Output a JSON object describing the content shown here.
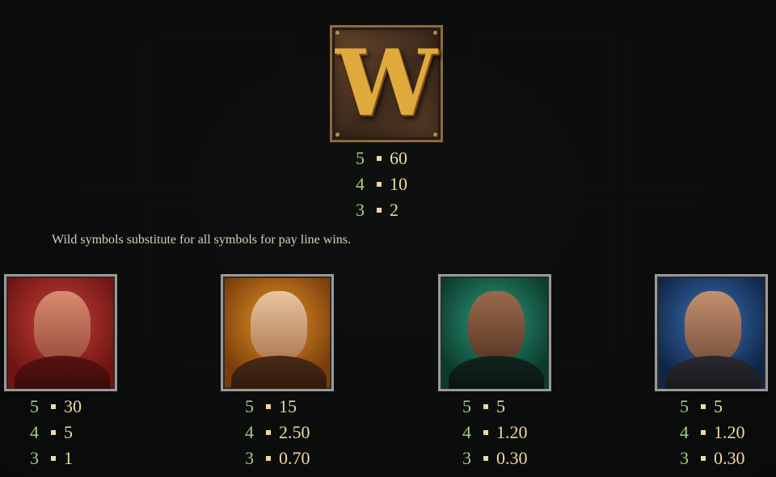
{
  "wild_symbol": {
    "letter": "W",
    "icon": "wild-w-icon",
    "payouts": [
      {
        "count": "5",
        "value": "60"
      },
      {
        "count": "4",
        "value": "10"
      },
      {
        "count": "3",
        "value": "2"
      }
    ]
  },
  "description": "Wild symbols substitute for all symbols for pay line wins.",
  "symbols": [
    {
      "icon": "red-warrior-icon",
      "payouts": [
        {
          "count": "5",
          "value": "30"
        },
        {
          "count": "4",
          "value": "5"
        },
        {
          "count": "3",
          "value": "1"
        }
      ]
    },
    {
      "icon": "old-man-icon",
      "payouts": [
        {
          "count": "5",
          "value": "15"
        },
        {
          "count": "4",
          "value": "2.50"
        },
        {
          "count": "3",
          "value": "0.70"
        }
      ]
    },
    {
      "icon": "green-lady-icon",
      "payouts": [
        {
          "count": "5",
          "value": "5"
        },
        {
          "count": "4",
          "value": "1.20"
        },
        {
          "count": "3",
          "value": "0.30"
        }
      ]
    },
    {
      "icon": "blue-pirate-icon",
      "payouts": [
        {
          "count": "5",
          "value": "5"
        },
        {
          "count": "4",
          "value": "1.20"
        },
        {
          "count": "3",
          "value": "0.30"
        }
      ]
    }
  ],
  "colors": {
    "count": "#9fd27c",
    "value": "#f0d9a0",
    "wild_gold": "#e0a93c"
  }
}
